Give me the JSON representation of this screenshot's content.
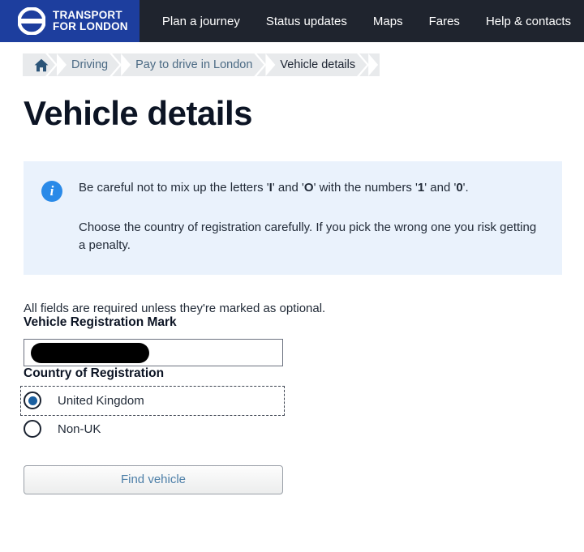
{
  "navbar": {
    "brand": {
      "line1": "TRANSPORT",
      "line2": "FOR LONDON",
      "logo_icon": "tfl-roundel-icon",
      "background": "#1d3e9e"
    },
    "background": "#1f242e",
    "links": [
      {
        "label": "Plan a journey"
      },
      {
        "label": "Status updates"
      },
      {
        "label": "Maps"
      },
      {
        "label": "Fares"
      },
      {
        "label": "Help & contacts"
      }
    ]
  },
  "breadcrumb": {
    "home_icon": "home-icon",
    "items": [
      {
        "label": "Driving",
        "current": false
      },
      {
        "label": "Pay to drive in London",
        "current": false
      },
      {
        "label": "Vehicle details",
        "current": true
      }
    ]
  },
  "page": {
    "title": "Vehicle details"
  },
  "info_panel": {
    "icon": "info-circle-icon",
    "accent": "#2a8ae8",
    "background": "#eaf2fc",
    "paragraph1": {
      "part1": "Be careful not to mix up the letters '",
      "bold1": "I",
      "part2": "' and '",
      "bold2": "O",
      "part3": "' with the numbers '",
      "bold3": "1",
      "part4": "' and '",
      "bold4": "0",
      "part5": "'."
    },
    "paragraph2": "Choose the country of registration carefully. If you pick the wrong one you risk getting a penalty."
  },
  "form": {
    "note": "All fields are required unless they're marked as optional.",
    "vrm": {
      "label": "Vehicle Registration Mark",
      "value": "",
      "placeholder": "",
      "redacted": true
    },
    "country": {
      "label": "Country of Registration",
      "options": [
        {
          "label": "United Kingdom",
          "checked": true,
          "focused": true
        },
        {
          "label": "Non-UK",
          "checked": false,
          "focused": false
        }
      ]
    },
    "submit_label": "Find vehicle"
  }
}
